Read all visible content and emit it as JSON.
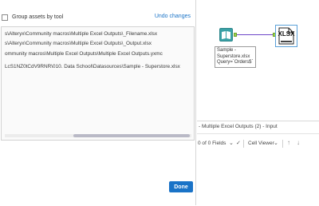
{
  "dialog": {
    "group_label": "Group assets by tool",
    "undo_label": "Undo changes",
    "assets": [
      "s\\Alteryx\\Community macros\\Multiple Excel Outputs\\_Filename.xlsx",
      "s\\Alteryx\\Community macros\\Multiple Excel Outputs\\_Output.xlsx",
      "ommunity macros\\Multiple Excel Outputs\\Multiple Excel Outputs.yxmc",
      "LcS1NZ0tCdV9RNR\\010. Data School\\Datasources\\Sample - Superstore.xlsx"
    ],
    "done_label": "Done"
  },
  "canvas": {
    "annotation_lines": [
      "Sample -",
      "Superstore.xlsx",
      "Query=`Orders$`"
    ],
    "output_icon_text": "XLSX"
  },
  "results": {
    "title": "- Multiple Excel Outputs (2) - Input",
    "fields": "0 of 0 Fields",
    "cell_viewer": "Cell Viewer"
  },
  "colors": {
    "accent": "#1a73c7",
    "input_tool": "#3aa1a6",
    "connector": "#6d46c8",
    "anchor": "#9dd64a"
  }
}
